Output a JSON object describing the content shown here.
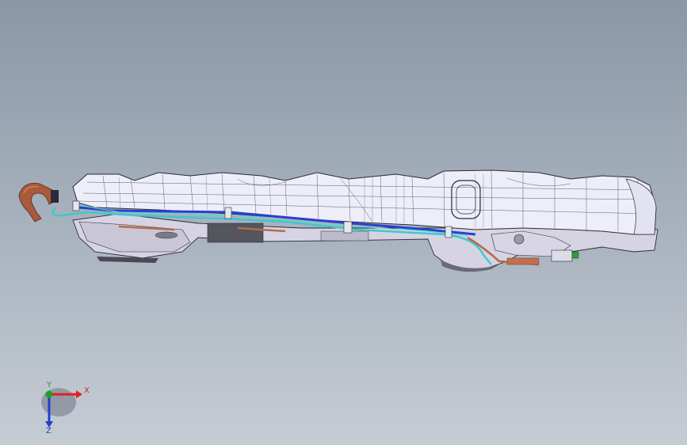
{
  "viewport": {
    "background_top": "#8a97a5",
    "background_bottom": "#c6ccd4"
  },
  "model": {
    "description_icon": "fuel-tank-assembly-model",
    "colors": {
      "shell_fill": "#eeeef8",
      "edge": "#2a2a38",
      "pipe_blue": "#2b3fd0",
      "pipe_teal": "#3fc8c8",
      "hose_copper": "#b86a4a",
      "filler_neck": "#a85a3c",
      "connector_green": "#2f9a3f"
    }
  },
  "triad": {
    "x_label": "X",
    "y_label": "Y",
    "z_label": "Z",
    "x_color": "#e02020",
    "y_color": "#20a020",
    "z_color": "#2040d0"
  }
}
